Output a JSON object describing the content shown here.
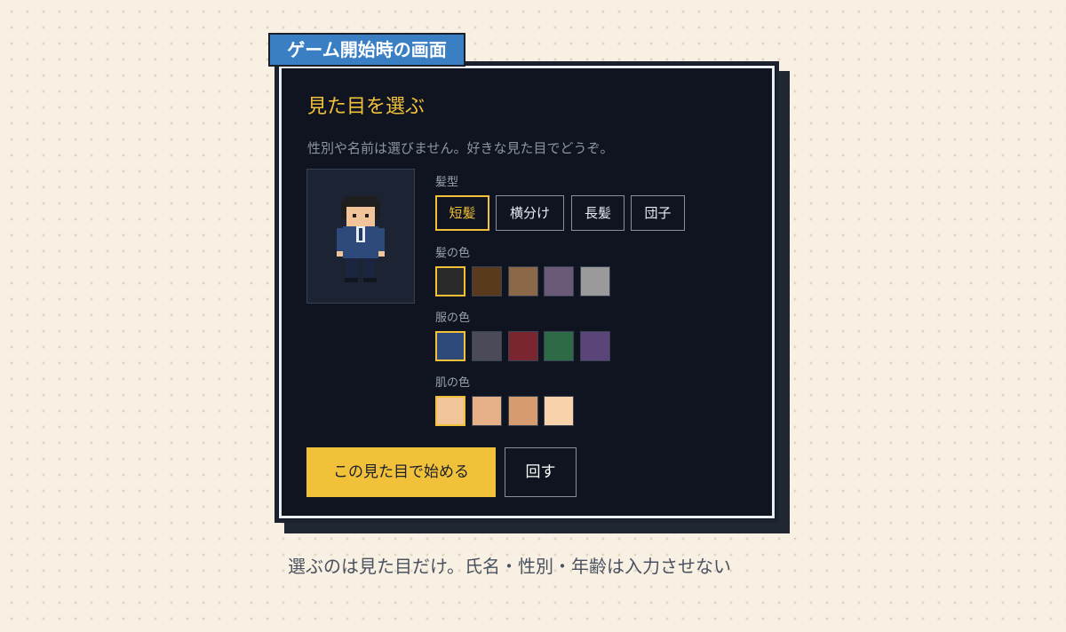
{
  "frame_label": "ゲーム開始時の画面",
  "dialog": {
    "title": "見た目を選ぶ",
    "description": "性別や名前は選びません。好きな見た目でどうぞ。"
  },
  "hair_style": {
    "label": "髪型",
    "options": [
      "短髪",
      "横分け",
      "長髪",
      "団子"
    ],
    "selected": "短髪"
  },
  "hair_color": {
    "label": "髪の色",
    "swatches": [
      "#2a2a2a",
      "#5a3a1c",
      "#8a6848",
      "#6a5a78",
      "#9a9a9a"
    ],
    "selected": "#2a2a2a"
  },
  "clothes_color": {
    "label": "服の色",
    "swatches": [
      "#2e4a7a",
      "#4a4a58",
      "#7a2630",
      "#2e6a46",
      "#5a4478"
    ],
    "selected": "#2e4a7a"
  },
  "skin_color": {
    "label": "肌の色",
    "swatches": [
      "#f2c49a",
      "#e6b088",
      "#d69c70",
      "#f8d2aa"
    ],
    "selected": "#f2c49a"
  },
  "actions": {
    "start": "この見た目で始める",
    "spin": "回す"
  },
  "caption": "選ぶのは見た目だけ。氏名・性別・年齢は入力させない"
}
